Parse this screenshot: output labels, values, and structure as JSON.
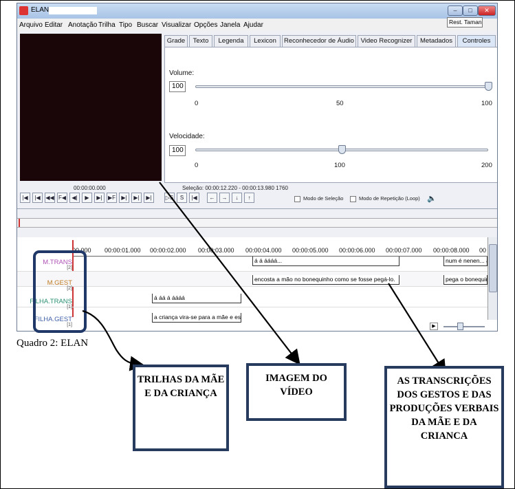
{
  "window": {
    "title": "ELAN -",
    "buttons": {
      "minimize": "–",
      "maximize": "□",
      "close": "✕"
    }
  },
  "menu": [
    "Arquivo",
    "Editar",
    "Anotação",
    "Trilha",
    "Tipo",
    "Buscar",
    "Visualizar",
    "Opções",
    "Janela",
    "Ajudar"
  ],
  "rest_button": "Rest. Tamanho",
  "tabs": [
    "Grade",
    "Texto",
    "Legenda",
    "Lexicon",
    "Reconhecedor de Áudio",
    "Video Recognizer",
    "Metadados",
    "Controles"
  ],
  "active_tab": "Controles",
  "controls": {
    "volume": {
      "label": "Volume:",
      "value": "100",
      "ticks": [
        "0",
        "50",
        "100"
      ],
      "level": 100
    },
    "speed": {
      "label": "Velocidade:",
      "value": "100",
      "ticks": [
        "0",
        "100",
        "200"
      ],
      "level": 100
    }
  },
  "media_time": "00:00:00.000",
  "selection": "Seleção: 00:00:12.220 - 00:00:13.980  1760",
  "player_buttons": [
    "|◀",
    "|◀",
    "◀◀",
    "F◀",
    "◀|",
    "▶",
    "▶|",
    "▶F",
    "▶|",
    "▶|",
    "▶|"
  ],
  "sel_buttons": [
    "▷S",
    "S",
    "|◀"
  ],
  "nav_buttons": [
    "←",
    "→",
    "↓",
    "↑"
  ],
  "checkboxes": {
    "selection_mode": "Modo de Seleção",
    "loop_mode": "Modo de Repetição (Loop)"
  },
  "ruler": [
    "00.000",
    "00:00:01.000",
    "00:00:02.000",
    "00:00:03.000",
    "00:00:04.000",
    "00:00:05.000",
    "00:00:06.000",
    "00:00:07.000",
    "00:00:08.000",
    "00"
  ],
  "tiers": [
    {
      "name": "M.TRANS",
      "count": "[2]",
      "color": "#b055b8"
    },
    {
      "name": "M.GEST",
      "count": "[2]",
      "color": "#c07a20"
    },
    {
      "name": "FILHA.TRANS",
      "count": "[1]",
      "color": "#2b8f73"
    },
    {
      "name": "FILHA.GEST",
      "count": "[1]",
      "color": "#3f5fa8"
    }
  ],
  "annotations": {
    "m_trans_1": "á á áááá...",
    "m_trans_2": "num é nenen... á",
    "m_gest_1": "encosta a mão no bonequinho como se fosse pegá-lo.",
    "m_gest_2": "pega o bonequin",
    "filha_trans_1": "á áá á áááá",
    "filha_gest_1": "a criança vira-se para a mãe e es"
  },
  "caption": "Quadro 2: ELAN",
  "callouts": {
    "tracks": "TRILHAS DA MÃE E DA CRIANÇA",
    "video": "IMAGEM DO VÍDEO",
    "transcriptions": "AS TRANSCRIÇÕES DOS GESTOS E DAS PRODUÇÕES VERBAIS DA MÃE E DA CRIANCA"
  },
  "colors": {
    "callout_border": "#263b5e",
    "video_bg": "#1a0508"
  }
}
